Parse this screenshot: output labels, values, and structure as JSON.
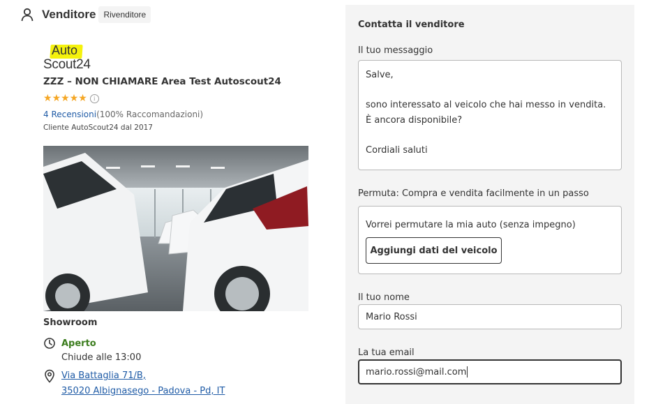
{
  "seller": {
    "title": "Venditore",
    "badge": "Rivenditore",
    "logo_top": "Auto",
    "logo_bottom": "Scout24",
    "dealer_name": "ZZZ – NON CHIAMARE Area Test Autoscout24",
    "rating_stars": 5,
    "reviews_link": "4 Recensioni",
    "recommendations": "(100% Raccomandazioni)",
    "client_since": "Cliente AutoScout24 dal 2017",
    "photo_label": "Showroom",
    "open_status": "Aperto",
    "closes_at": "Chiude alle 13:00",
    "address_line1": "Via Battaglia 71/B,",
    "address_line2": "35020 Albignasego - Padova - Pd, IT"
  },
  "contact": {
    "title": "Contatta il venditore",
    "message_label": "Il tuo messaggio",
    "message_lines": [
      "Salve,",
      "",
      "sono interessato al veicolo che hai messo in vendita. È ancora disponibile?",
      "",
      "Cordiali saluti"
    ],
    "tradein_label": "Permuta: Compra e vendita facilmente in un passo",
    "tradein_text": "Vorrei permutare la mia auto (senza impegno)",
    "tradein_button": "Aggiungi dati del veicolo",
    "name_label": "Il tuo nome",
    "name_value": "Mario Rossi",
    "email_label": "La tua email",
    "email_value": "mario.rossi@mail.com"
  },
  "colors": {
    "link": "#1f5ba6",
    "open_green": "#3c7d1e",
    "star": "#f5a623",
    "logo_highlight": "#f5f20d",
    "panel_bg": "#f4f4f4"
  },
  "icons": [
    "person-icon",
    "info-icon",
    "clock-icon",
    "map-pin-icon",
    "star-icon"
  ]
}
